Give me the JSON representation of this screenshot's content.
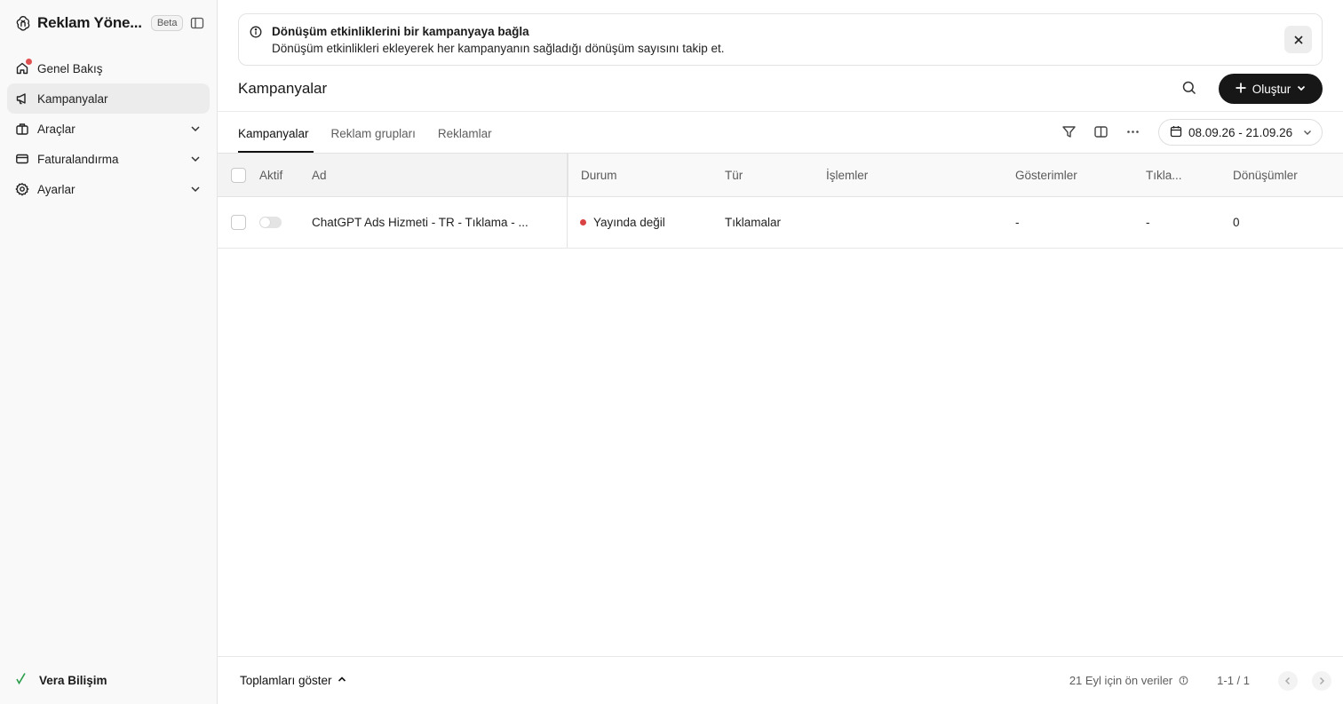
{
  "app": {
    "title": "Reklam Yöne...",
    "badge": "Beta"
  },
  "sidebar": {
    "items": [
      {
        "label": "Genel Bakış",
        "icon": "home-icon"
      },
      {
        "label": "Kampanyalar",
        "icon": "megaphone-icon"
      },
      {
        "label": "Araçlar",
        "icon": "tools-icon"
      },
      {
        "label": "Faturalandırma",
        "icon": "credit-card-icon"
      },
      {
        "label": "Ayarlar",
        "icon": "gear-icon"
      }
    ],
    "workspace": "Vera Bilişim"
  },
  "banner": {
    "title": "Dönüşüm etkinliklerini bir kampanyaya bağla",
    "description": "Dönüşüm etkinlikleri ekleyerek her kampanyanın sağladığı dönüşüm sayısını takip et."
  },
  "header": {
    "title": "Kampanyalar",
    "create_label": "Oluştur"
  },
  "tabs": [
    {
      "label": "Kampanyalar"
    },
    {
      "label": "Reklam grupları"
    },
    {
      "label": "Reklamlar"
    }
  ],
  "toolbar": {
    "date_range": "08.09.26 - 21.09.26"
  },
  "table": {
    "columns": [
      "Aktif",
      "Ad",
      "Durum",
      "Tür",
      "İşlemler",
      "Gösterimler",
      "Tıkla...",
      "Dönüşümler"
    ],
    "rows": [
      {
        "name": "ChatGPT Ads Hizmeti - TR - Tıklama - ...",
        "status": "Yayında değil",
        "type": "Tıklamalar",
        "operations": "",
        "impressions": "-",
        "clicks": "-",
        "conversions": "0"
      }
    ]
  },
  "footer": {
    "totals_label": "Toplamları göster",
    "data_note": "21 Eyl için ön veriler",
    "pagination": "1-1 / 1"
  },
  "colors": {
    "primary_button": "#171717",
    "status_inactive": "#d94343",
    "notification_dot": "#e05252",
    "workspace_logo": "#2a9d4b"
  }
}
